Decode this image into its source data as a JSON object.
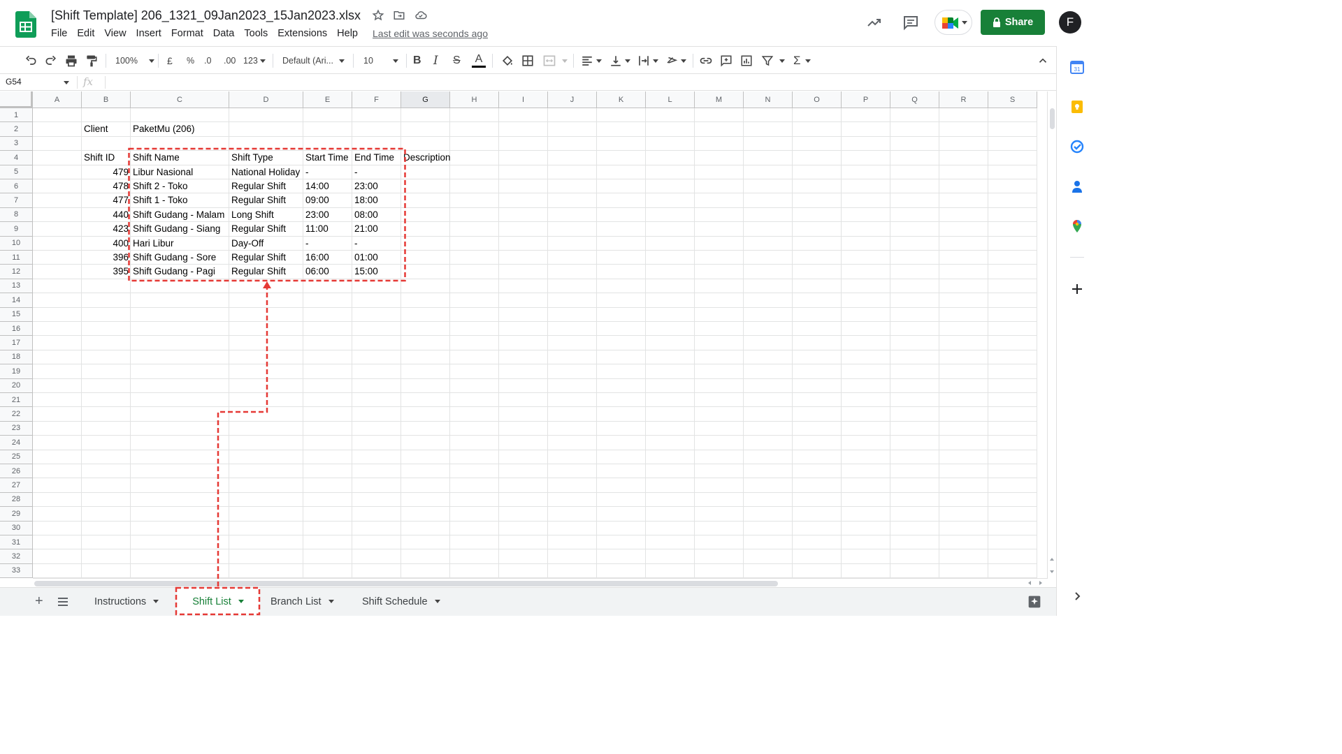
{
  "header": {
    "doc_title": "[Shift Template] 206_1321_09Jan2023_15Jan2023.xlsx",
    "menus": [
      "File",
      "Edit",
      "View",
      "Insert",
      "Format",
      "Data",
      "Tools",
      "Extensions",
      "Help"
    ],
    "last_edit": "Last edit was seconds ago",
    "share_label": "Share",
    "avatar_initial": "F"
  },
  "toolbar": {
    "zoom": "100%",
    "currency": "£",
    "percent": "%",
    "dec_less": ".0",
    "dec_more": ".00",
    "number_format": "123",
    "font": "Default (Ari...",
    "font_size": "10"
  },
  "formula_bar": {
    "name_box": "G54",
    "fx": "fx"
  },
  "grid": {
    "columns": [
      "A",
      "B",
      "C",
      "D",
      "E",
      "F",
      "G",
      "H",
      "I",
      "J",
      "K",
      "L",
      "M",
      "N",
      "O",
      "P",
      "Q",
      "R",
      "S"
    ],
    "selected_column": "G",
    "rows": [
      "1",
      "2",
      "3",
      "4",
      "5",
      "6",
      "7",
      "8",
      "9",
      "10",
      "11",
      "12",
      "13",
      "14",
      "15",
      "16",
      "17",
      "18",
      "19",
      "20",
      "21",
      "22",
      "23",
      "24",
      "25",
      "26",
      "27",
      "28",
      "29",
      "30",
      "31",
      "32",
      "33"
    ],
    "client_label": "Client",
    "client_value": "PaketMu (206)",
    "table_headers": [
      "Shift ID",
      "Shift Name",
      "Shift Type",
      "Start Time",
      "End Time",
      "Description"
    ],
    "table_rows": [
      {
        "id": "479",
        "name": "Libur Nasional",
        "type": "National Holiday",
        "start": "-",
        "end": "-"
      },
      {
        "id": "478",
        "name": "Shift 2 - Toko",
        "type": "Regular Shift",
        "start": "14:00",
        "end": "23:00"
      },
      {
        "id": "477",
        "name": "Shift 1 - Toko",
        "type": "Regular Shift",
        "start": "09:00",
        "end": "18:00"
      },
      {
        "id": "440",
        "name": "Shift Gudang - Malam",
        "type": "Long Shift",
        "start": "23:00",
        "end": "08:00"
      },
      {
        "id": "423",
        "name": "Shift Gudang - Siang",
        "type": "Regular Shift",
        "start": "11:00",
        "end": "21:00"
      },
      {
        "id": "400",
        "name": "Hari Libur",
        "type": "Day-Off",
        "start": "-",
        "end": "-"
      },
      {
        "id": "396",
        "name": "Shift Gudang - Sore",
        "type": "Regular Shift",
        "start": "16:00",
        "end": "01:00"
      },
      {
        "id": "395",
        "name": "Shift Gudang - Pagi",
        "type": "Regular Shift",
        "start": "06:00",
        "end": "15:00"
      }
    ]
  },
  "sheet_tabs": [
    {
      "label": "Instructions",
      "active": false
    },
    {
      "label": "Shift List",
      "active": true
    },
    {
      "label": "Branch List",
      "active": false
    },
    {
      "label": "Shift Schedule",
      "active": false
    }
  ],
  "colors": {
    "sheets_green": "#188038",
    "annotation_red": "#e53935",
    "header_bg": "#f8f9fa"
  },
  "side_panel_icons": [
    "calendar-icon",
    "keep-icon",
    "tasks-icon",
    "contacts-icon",
    "maps-icon",
    "add-icon"
  ]
}
